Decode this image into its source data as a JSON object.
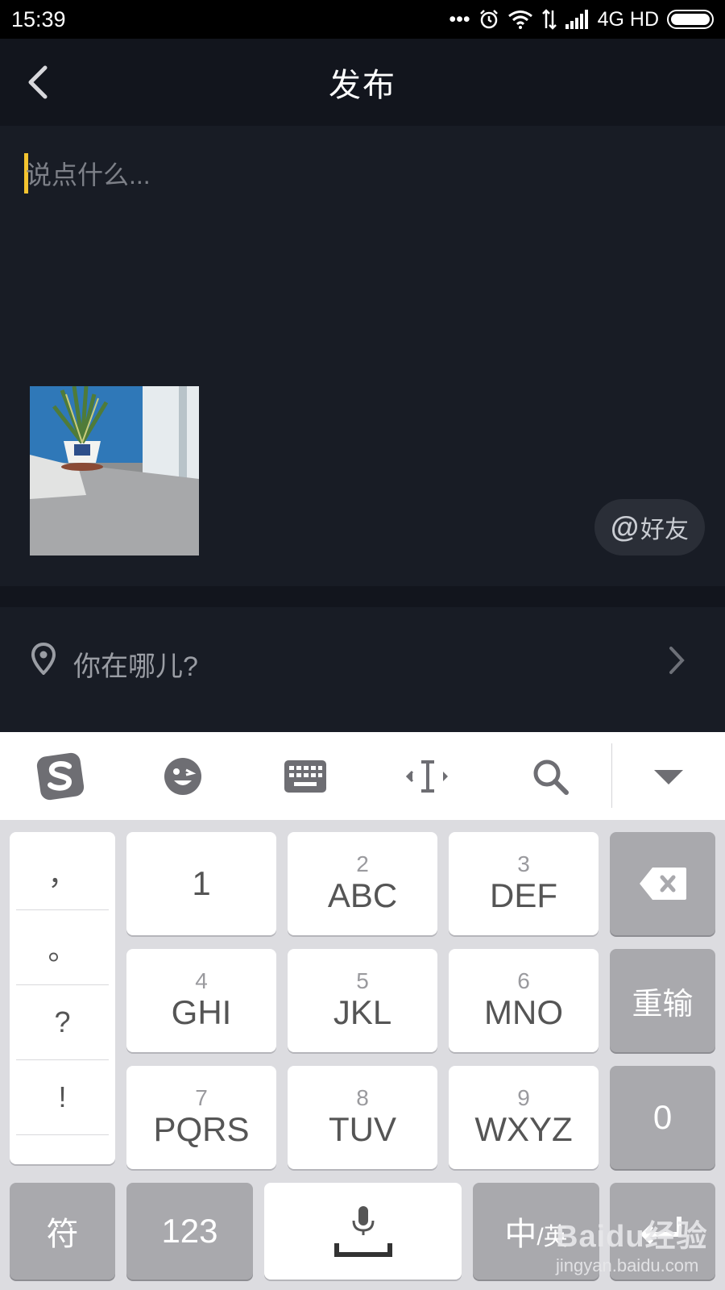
{
  "status_bar": {
    "time": "15:39",
    "network": "4G HD"
  },
  "nav": {
    "title": "发布"
  },
  "compose": {
    "placeholder": "说点什么...",
    "at_friend_symbol": "@",
    "at_friend_label": "好友"
  },
  "location": {
    "label": "你在哪儿?"
  },
  "keyboard": {
    "toolbar_icons": [
      "sogou-logo-icon",
      "emoji-icon",
      "keyboard-icon",
      "cursor-move-icon",
      "search-icon",
      "collapse-keyboard-icon"
    ],
    "punctuation": [
      "，",
      "。",
      "?",
      "!"
    ],
    "keys": [
      {
        "num": "",
        "letters": "1"
      },
      {
        "num": "2",
        "letters": "ABC"
      },
      {
        "num": "3",
        "letters": "DEF"
      },
      {
        "num": "4",
        "letters": "GHI"
      },
      {
        "num": "5",
        "letters": "JKL"
      },
      {
        "num": "6",
        "letters": "MNO"
      },
      {
        "num": "7",
        "letters": "PQRS"
      },
      {
        "num": "8",
        "letters": "TUV"
      },
      {
        "num": "9",
        "letters": "WXYZ"
      }
    ],
    "reinput": "重输",
    "zero": "0",
    "symbols": "符",
    "numbers": "123",
    "lang_primary": "中",
    "lang_secondary": "/英"
  },
  "watermark": {
    "brand": "Baidu经验",
    "url": "jingyan.baidu.com"
  },
  "colors": {
    "accent_cursor": "#f4c430",
    "background": "#181c25"
  }
}
